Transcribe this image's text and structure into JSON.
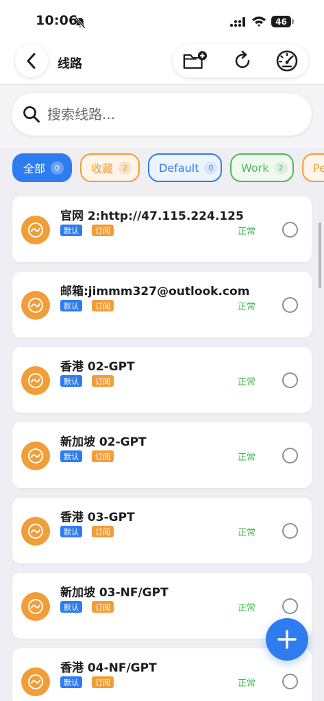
{
  "status_bar": {
    "time": "10:06",
    "battery": "46"
  },
  "nav": {
    "title": "线路"
  },
  "search": {
    "placeholder": "搜索线路..."
  },
  "filters": [
    {
      "label": "全部",
      "count": "0"
    },
    {
      "label": "收藏",
      "count": "2"
    },
    {
      "label": "Default",
      "count": "0"
    },
    {
      "label": "Work",
      "count": "2"
    },
    {
      "label": "Pe",
      "count": ""
    }
  ],
  "routes": [
    {
      "name": "官网 2:http://47.115.224.125",
      "tag_default": "默认",
      "tag_sub": "订阅",
      "status": "正常"
    },
    {
      "name": "邮箱:jimmm327@outlook.com",
      "tag_default": "默认",
      "tag_sub": "订阅",
      "status": "正常"
    },
    {
      "name": "香港 02-GPT",
      "tag_default": "默认",
      "tag_sub": "订阅",
      "status": "正常"
    },
    {
      "name": "新加坡 02-GPT",
      "tag_default": "默认",
      "tag_sub": "订阅",
      "status": "正常"
    },
    {
      "name": "香港 03-GPT",
      "tag_default": "默认",
      "tag_sub": "订阅",
      "status": "正常"
    },
    {
      "name": "新加坡 03-NF/GPT",
      "tag_default": "默认",
      "tag_sub": "订阅",
      "status": "正常"
    },
    {
      "name": "香港 04-NF/GPT",
      "tag_default": "默认",
      "tag_sub": "订阅",
      "status": "正常"
    }
  ],
  "colors": {
    "accent_blue": "#2e7df0",
    "orange": "#f19d38",
    "green": "#3cba4a",
    "text": "#1c1c1e"
  },
  "icons": {
    "back": "chevron-left-icon",
    "new_folder": "folder-plus-icon",
    "refresh": "refresh-icon",
    "speed_test": "speedometer-icon",
    "search": "search-icon",
    "route": "route-wave-icon",
    "add": "plus-icon"
  }
}
